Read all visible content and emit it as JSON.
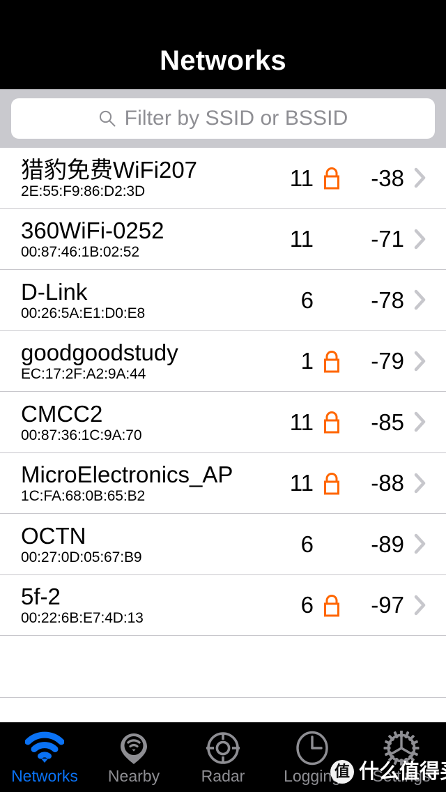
{
  "navbar": {
    "title": "Networks"
  },
  "search": {
    "icon": "search-icon",
    "value": "",
    "placeholder": "Filter by SSID or BSSID"
  },
  "colors": {
    "lock": "#ff6600",
    "active_tab": "#0a72f5",
    "inactive_tab": "#8e8e93",
    "navbar_bg": "#000000",
    "searchbar_bg": "#c9c9ce",
    "separator": "#c8c7cc",
    "chevron": "#c7c7cc"
  },
  "list": {
    "columns": [
      "ssid",
      "bssid",
      "channel",
      "secured",
      "rssi"
    ],
    "rows": [
      {
        "ssid": "猎豹免费WiFi207",
        "bssid": "2E:55:F9:86:D2:3D",
        "channel": "11",
        "secured": true,
        "rssi": "-38"
      },
      {
        "ssid": "360WiFi-0252",
        "bssid": "00:87:46:1B:02:52",
        "channel": "11",
        "secured": false,
        "rssi": "-71"
      },
      {
        "ssid": "D-Link",
        "bssid": "00:26:5A:E1:D0:E8",
        "channel": "6",
        "secured": false,
        "rssi": "-78"
      },
      {
        "ssid": "goodgoodstudy",
        "bssid": "EC:17:2F:A2:9A:44",
        "channel": "1",
        "secured": true,
        "rssi": "-79"
      },
      {
        "ssid": "CMCC2",
        "bssid": "00:87:36:1C:9A:70",
        "channel": "11",
        "secured": true,
        "rssi": "-85"
      },
      {
        "ssid": "MicroElectronics_AP",
        "bssid": "1C:FA:68:0B:65:B2",
        "channel": "11",
        "secured": true,
        "rssi": "-88"
      },
      {
        "ssid": "OCTN",
        "bssid": "00:27:0D:05:67:B9",
        "channel": "6",
        "secured": false,
        "rssi": "-89"
      },
      {
        "ssid": "5f-2",
        "bssid": "00:22:6B:E7:4D:13",
        "channel": "6",
        "secured": true,
        "rssi": "-97"
      }
    ]
  },
  "tabbar": {
    "active_index": 0,
    "tabs": [
      {
        "label": "Networks",
        "icon": "wifi-icon"
      },
      {
        "label": "Nearby",
        "icon": "map-pin-wifi-icon"
      },
      {
        "label": "Radar",
        "icon": "radar-target-icon"
      },
      {
        "label": "Logging",
        "icon": "clock-icon"
      },
      {
        "label": "Settings",
        "icon": "gear-icon"
      }
    ]
  },
  "watermark": {
    "badge": "值",
    "text": "什么值得买"
  }
}
